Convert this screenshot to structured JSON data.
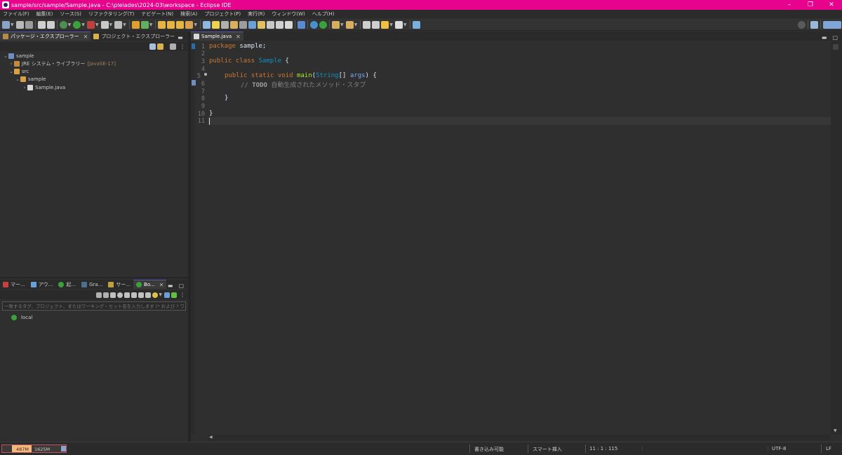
{
  "window": {
    "title": "sample/src/sample/Sample.java - C:\\pleiades\\2024-03\\workspace - Eclipse IDE",
    "minimize": "–",
    "maximize": "❐",
    "close": "✕"
  },
  "menu": [
    "ファイル(F)",
    "編集(E)",
    "ソース(S)",
    "リファクタリング(T)",
    "ナビゲート(N)",
    "検索(A)",
    "プロジェクト(P)",
    "実行(R)",
    "ウィンドウ(W)",
    "ヘルプ(H)"
  ],
  "left_top": {
    "tabs": [
      {
        "label": "パッケージ・エクスプローラー",
        "close": "✕"
      },
      {
        "label": "プロジェクト・エクスプローラー"
      }
    ],
    "tree": {
      "project": "sample",
      "jre": "JRE システム・ライブラリー",
      "jre_tag": "[JavaSE-17]",
      "src": "src",
      "package": "sample",
      "file": "Sample.java"
    }
  },
  "left_bottom": {
    "tabs": [
      "マー...",
      "アウ...",
      "起...",
      "Gra...",
      "サー...",
      "Bo..."
    ],
    "close": "✕",
    "filter_placeholder": "一致するタグ、プロジェクト、またはワーキング・セット名を入力します (* および ? ワイルドカ",
    "server": "local"
  },
  "editor": {
    "tab": "Sample.java",
    "close": "✕",
    "line_numbers": [
      "1",
      "2",
      "3",
      "4",
      "5",
      "6",
      "7",
      "8",
      "9",
      "10",
      "11"
    ],
    "code": {
      "l1_kw": "package",
      "l1_rest": " sample;",
      "l3_kw": "public class",
      "l3_cls": "Sample",
      "l3_rest": " {",
      "l5_kw": "public static void",
      "l5_fn": "main",
      "l5_open": "(",
      "l5_cls": "String",
      "l5_arr": "[]",
      "l5_arg": "args",
      "l5_rest": ") {",
      "l6_cm1": "// ",
      "l6_todo": "TODO",
      "l6_cm2": " 自動生成されたメソッド・スタブ",
      "l8": "}",
      "l10": "}"
    }
  },
  "status": {
    "heap_used": "487M",
    "heap_total": "1625M",
    "writable": "書き込み可能",
    "insert_mode": "スマート挿入",
    "position": "11 : 1 : 115",
    "encoding": "UTF-8",
    "line_ending": "LF"
  },
  "colors": {
    "titlebar": "#e8038c",
    "keyword": "#cc7832",
    "class": "#1290c3",
    "method": "#a7ec21",
    "comment": "#808080",
    "heap_bar": "#f5b77a"
  }
}
